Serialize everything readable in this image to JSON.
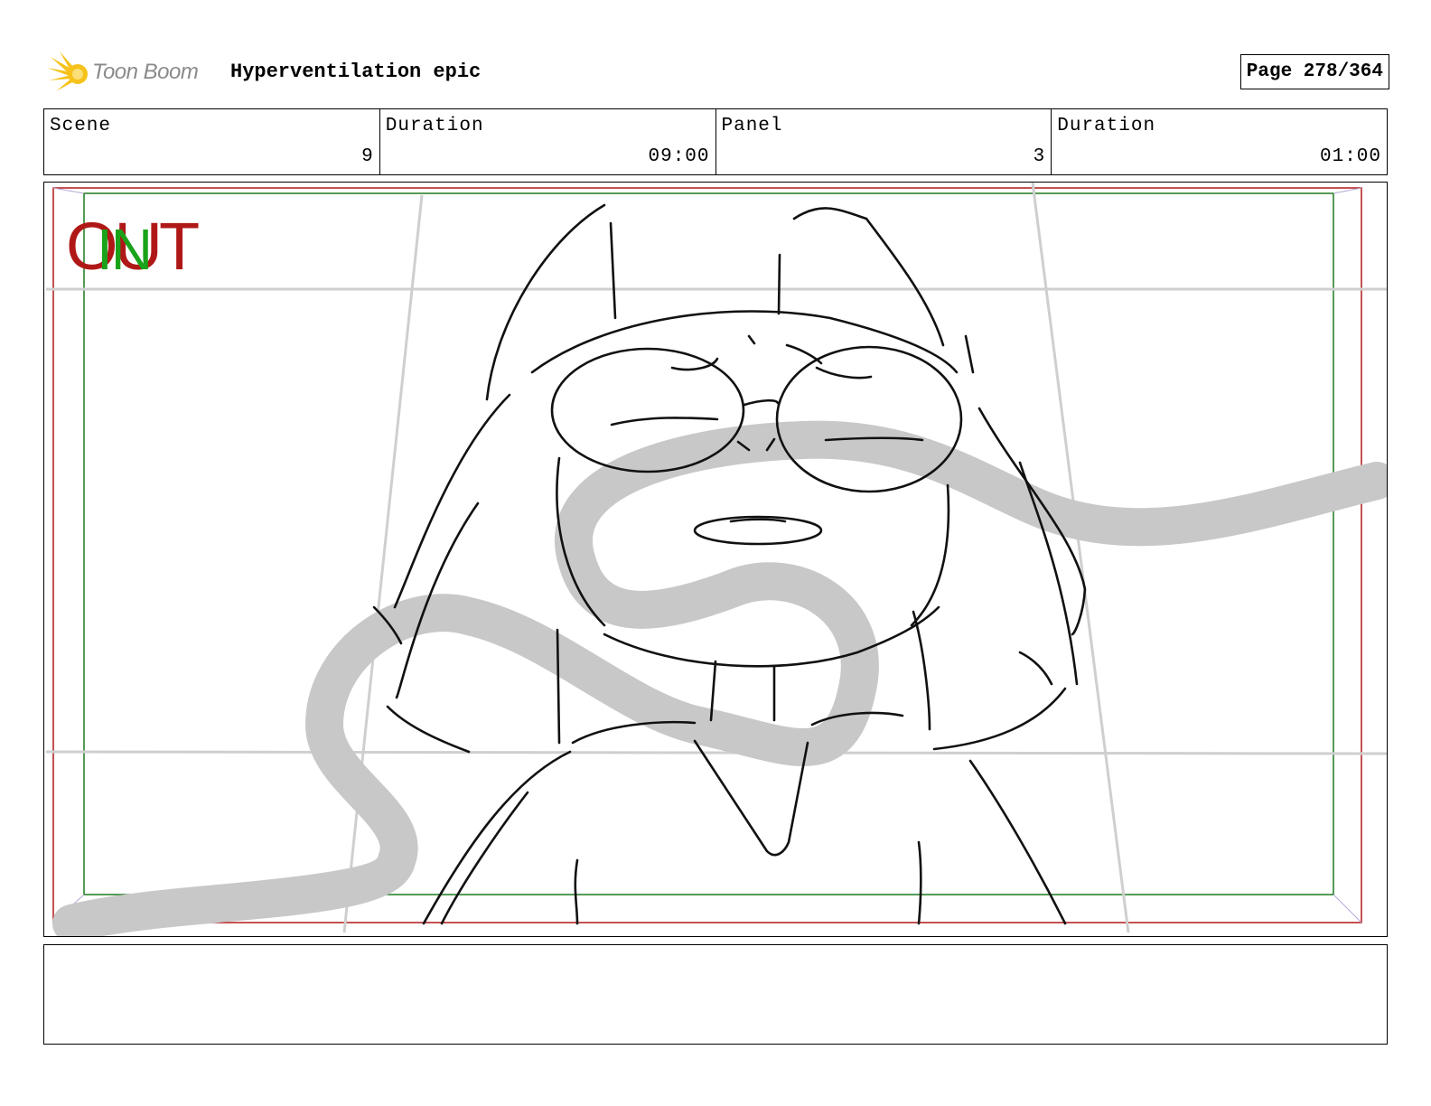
{
  "header": {
    "logo_text": "Toon Boom",
    "project_title": "Hyperventilation epic",
    "page_label": "Page 278/364"
  },
  "info": {
    "scene_label": "Scene",
    "scene_value": "9",
    "scene_duration_label": "Duration",
    "scene_duration_value": "09:00",
    "panel_label": "Panel",
    "panel_value": "3",
    "panel_duration_label": "Duration",
    "panel_duration_value": "01:00"
  },
  "panel_markers": {
    "out_label": "OUT",
    "in_label": "IN",
    "out_color": "#b01818",
    "in_color": "#1aa31a"
  },
  "caption": {
    "text": ""
  }
}
